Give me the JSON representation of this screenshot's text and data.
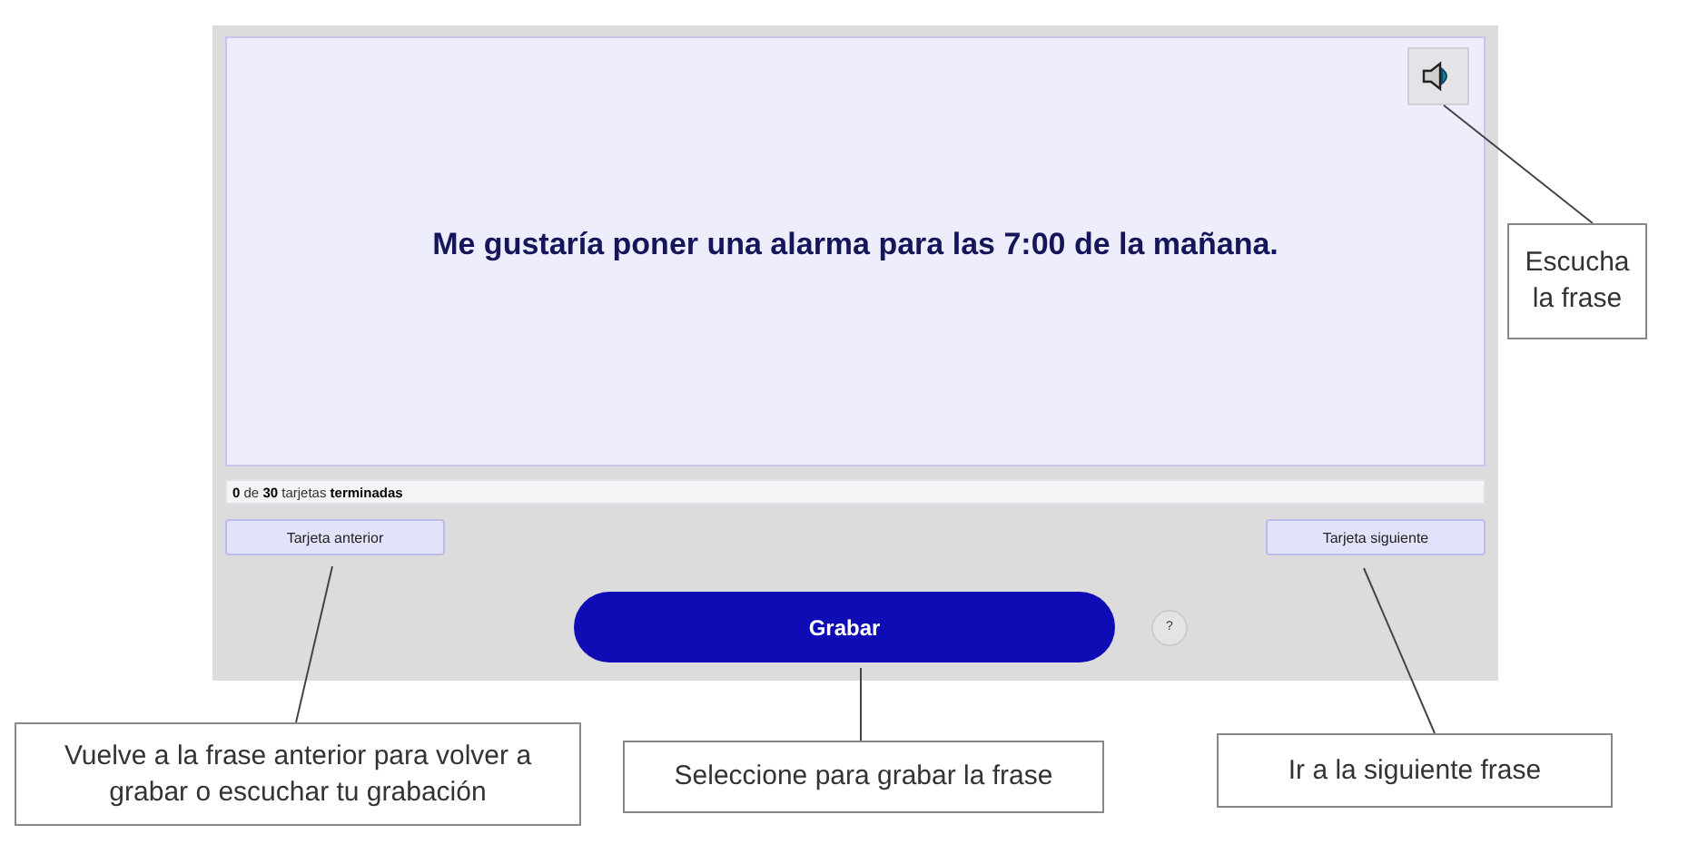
{
  "card": {
    "sentence": "Me gustaría poner una alarma para las 7:00 de la mañana."
  },
  "progress": {
    "text": "**0** de **30** tarjetas **terminadas**"
  },
  "buttons": {
    "previous": "Tarjeta anterior",
    "next": "Tarjeta siguiente",
    "record": "Grabar",
    "help": "?"
  },
  "annotations": [
    {
      "text": "Escucha la frase"
    },
    {
      "text": "Vuelve a la frase anterior para volver a grabar o escuchar tu grabación"
    },
    {
      "text": "Seleccione para grabar la frase"
    },
    {
      "text": "Ir a la siguiente frase"
    }
  ]
}
